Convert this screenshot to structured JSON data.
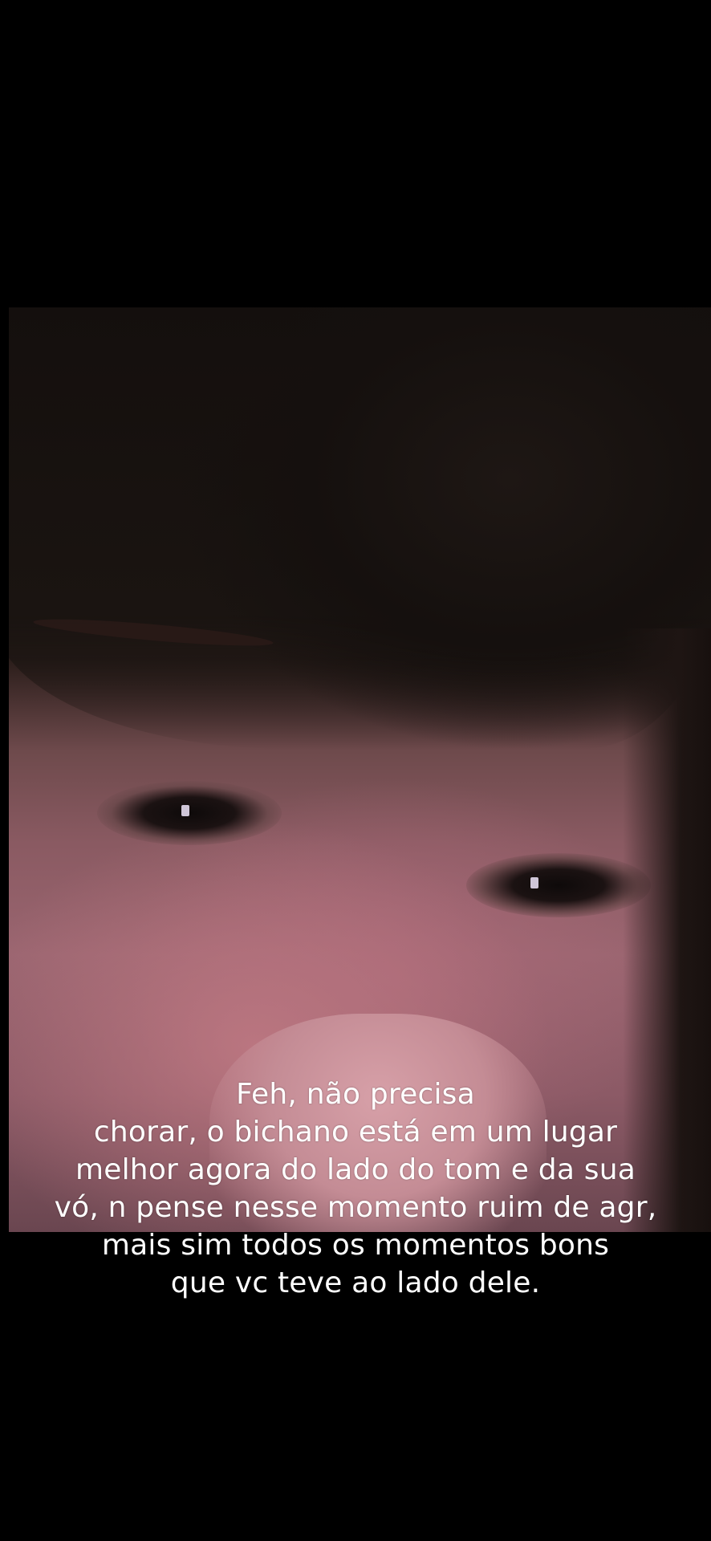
{
  "video": {
    "description_icon": "video-frame"
  },
  "caption": {
    "lines": [
      "Feh, não precisa",
      "chorar, o bichano está em um lugar",
      "melhor agora do lado do tom e da sua",
      "vó, n pense nesse momento ruim de agr,",
      "mais sim todos os momentos bons",
      "que vc teve ao lado dele."
    ],
    "color": "#ffffff"
  },
  "colors": {
    "background": "#000000"
  }
}
